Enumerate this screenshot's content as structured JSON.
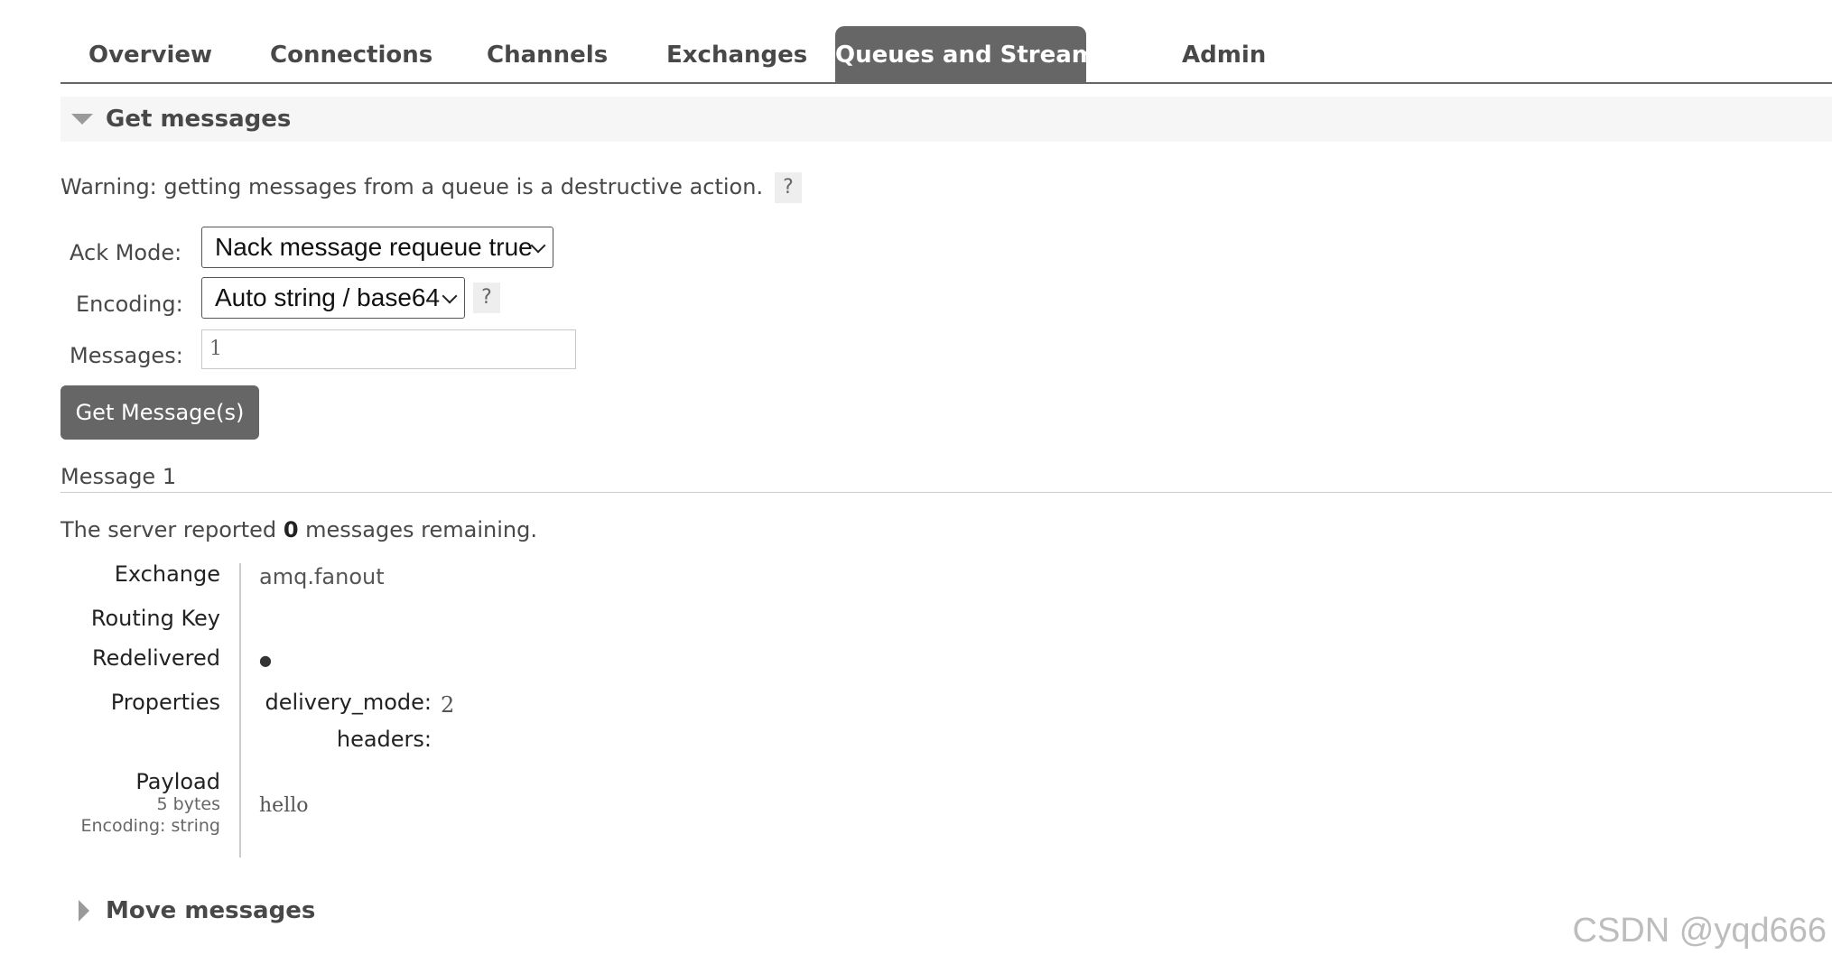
{
  "nav": {
    "tabs": [
      {
        "label": "Overview"
      },
      {
        "label": "Connections"
      },
      {
        "label": "Channels"
      },
      {
        "label": "Exchanges"
      },
      {
        "label": "Queues and Streams",
        "active": true
      },
      {
        "label": "Admin"
      }
    ]
  },
  "get_messages": {
    "title": "Get messages",
    "warning": "Warning: getting messages from a queue is a destructive action.",
    "help": "?",
    "ack_mode_label": "Ack Mode:",
    "ack_mode_value": "Nack message requeue true",
    "encoding_label": "Encoding:",
    "encoding_value": "Auto string / base64",
    "messages_label": "Messages:",
    "messages_value": "1",
    "button": "Get Message(s)"
  },
  "result": {
    "message_heading": "Message 1",
    "report_prefix": "The server reported",
    "remaining_count": "0",
    "report_suffix": "messages remaining.",
    "fields": {
      "exchange_label": "Exchange",
      "exchange_value": "amq.fanout",
      "routing_key_label": "Routing Key",
      "routing_key_value": "",
      "redelivered_label": "Redelivered",
      "redelivered_value": "●",
      "properties_label": "Properties",
      "delivery_mode_label": "delivery_mode:",
      "delivery_mode_value": "2",
      "headers_label": "headers:",
      "payload_label": "Payload",
      "payload_size": "5 bytes",
      "payload_encoding": "Encoding: string",
      "payload_value": "hello"
    }
  },
  "move_messages": {
    "title": "Move messages"
  },
  "watermark": "CSDN @yqd666"
}
